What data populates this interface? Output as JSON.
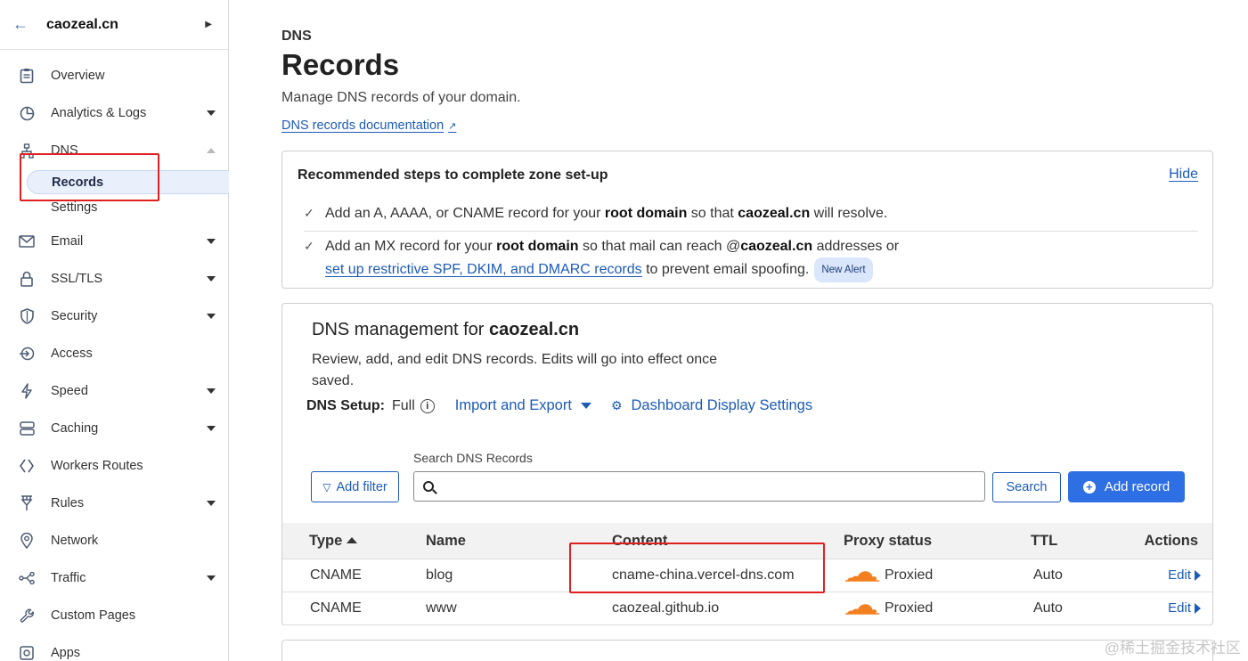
{
  "sidebar": {
    "domain": "caozeal.cn",
    "items": [
      {
        "label": "Overview",
        "icon": "clipboard-icon"
      },
      {
        "label": "Analytics & Logs",
        "icon": "chart-pie-icon"
      },
      {
        "label": "DNS",
        "icon": "network-icon"
      },
      {
        "label": "Email",
        "icon": "mail-icon"
      },
      {
        "label": "SSL/TLS",
        "icon": "lock-icon"
      },
      {
        "label": "Security",
        "icon": "shield-icon"
      },
      {
        "label": "Access",
        "icon": "access-icon"
      },
      {
        "label": "Speed",
        "icon": "bolt-icon"
      },
      {
        "label": "Caching",
        "icon": "server-icon"
      },
      {
        "label": "Workers Routes",
        "icon": "workers-icon"
      },
      {
        "label": "Rules",
        "icon": "rules-icon"
      },
      {
        "label": "Network",
        "icon": "location-pin-icon"
      },
      {
        "label": "Traffic",
        "icon": "traffic-icon"
      },
      {
        "label": "Custom Pages",
        "icon": "wrench-icon"
      },
      {
        "label": "Apps",
        "icon": "apps-icon"
      }
    ],
    "dns_sub": {
      "records": "Records",
      "settings": "Settings"
    }
  },
  "header": {
    "eyebrow": "DNS",
    "title": "Records",
    "description": "Manage DNS records of your domain.",
    "doc_link": "DNS records documentation"
  },
  "recommended": {
    "title": "Recommended steps to complete zone set-up",
    "hide": "Hide",
    "step1": {
      "pre": "Add an A, AAAA, or CNAME record for your ",
      "bold1": "root domain",
      "mid": " so that ",
      "bold2": "caozeal.cn",
      "post": " will resolve."
    },
    "step2": {
      "pre": "Add an MX record for your ",
      "bold1": "root domain",
      "mid": " so that mail can reach @",
      "bold2": "caozeal.cn",
      "post": " addresses or",
      "link": "set up restrictive SPF, DKIM, and DMARC records",
      "tail": " to prevent email spoofing.",
      "badge": "New Alert"
    }
  },
  "dns": {
    "title_pre": "DNS management for ",
    "title_domain": "caozeal.cn",
    "description": "Review, add, and edit DNS records. Edits will go into effect once saved.",
    "setup_label": "DNS Setup:",
    "setup_value": "Full",
    "import_export": "Import and Export",
    "display_settings": "Dashboard Display Settings",
    "search_label": "Search DNS Records",
    "search_placeholder": "",
    "add_filter": "Add filter",
    "search_btn": "Search",
    "add_record": "Add record",
    "columns": {
      "type": "Type",
      "name": "Name",
      "content": "Content",
      "proxy": "Proxy status",
      "ttl": "TTL",
      "actions": "Actions"
    },
    "rows": [
      {
        "type": "CNAME",
        "name": "blog",
        "content": "cname-china.vercel-dns.com",
        "proxy": "Proxied",
        "ttl": "Auto",
        "action": "Edit"
      },
      {
        "type": "CNAME",
        "name": "www",
        "content": "caozeal.github.io",
        "proxy": "Proxied",
        "ttl": "Auto",
        "action": "Edit"
      }
    ]
  },
  "watermark": "@稀土掘金技术社区",
  "colors": {
    "accent": "#1c5bb8",
    "primary_button": "#2f6fe4",
    "highlight_box": "#e02020",
    "cloud": "#f38020"
  }
}
